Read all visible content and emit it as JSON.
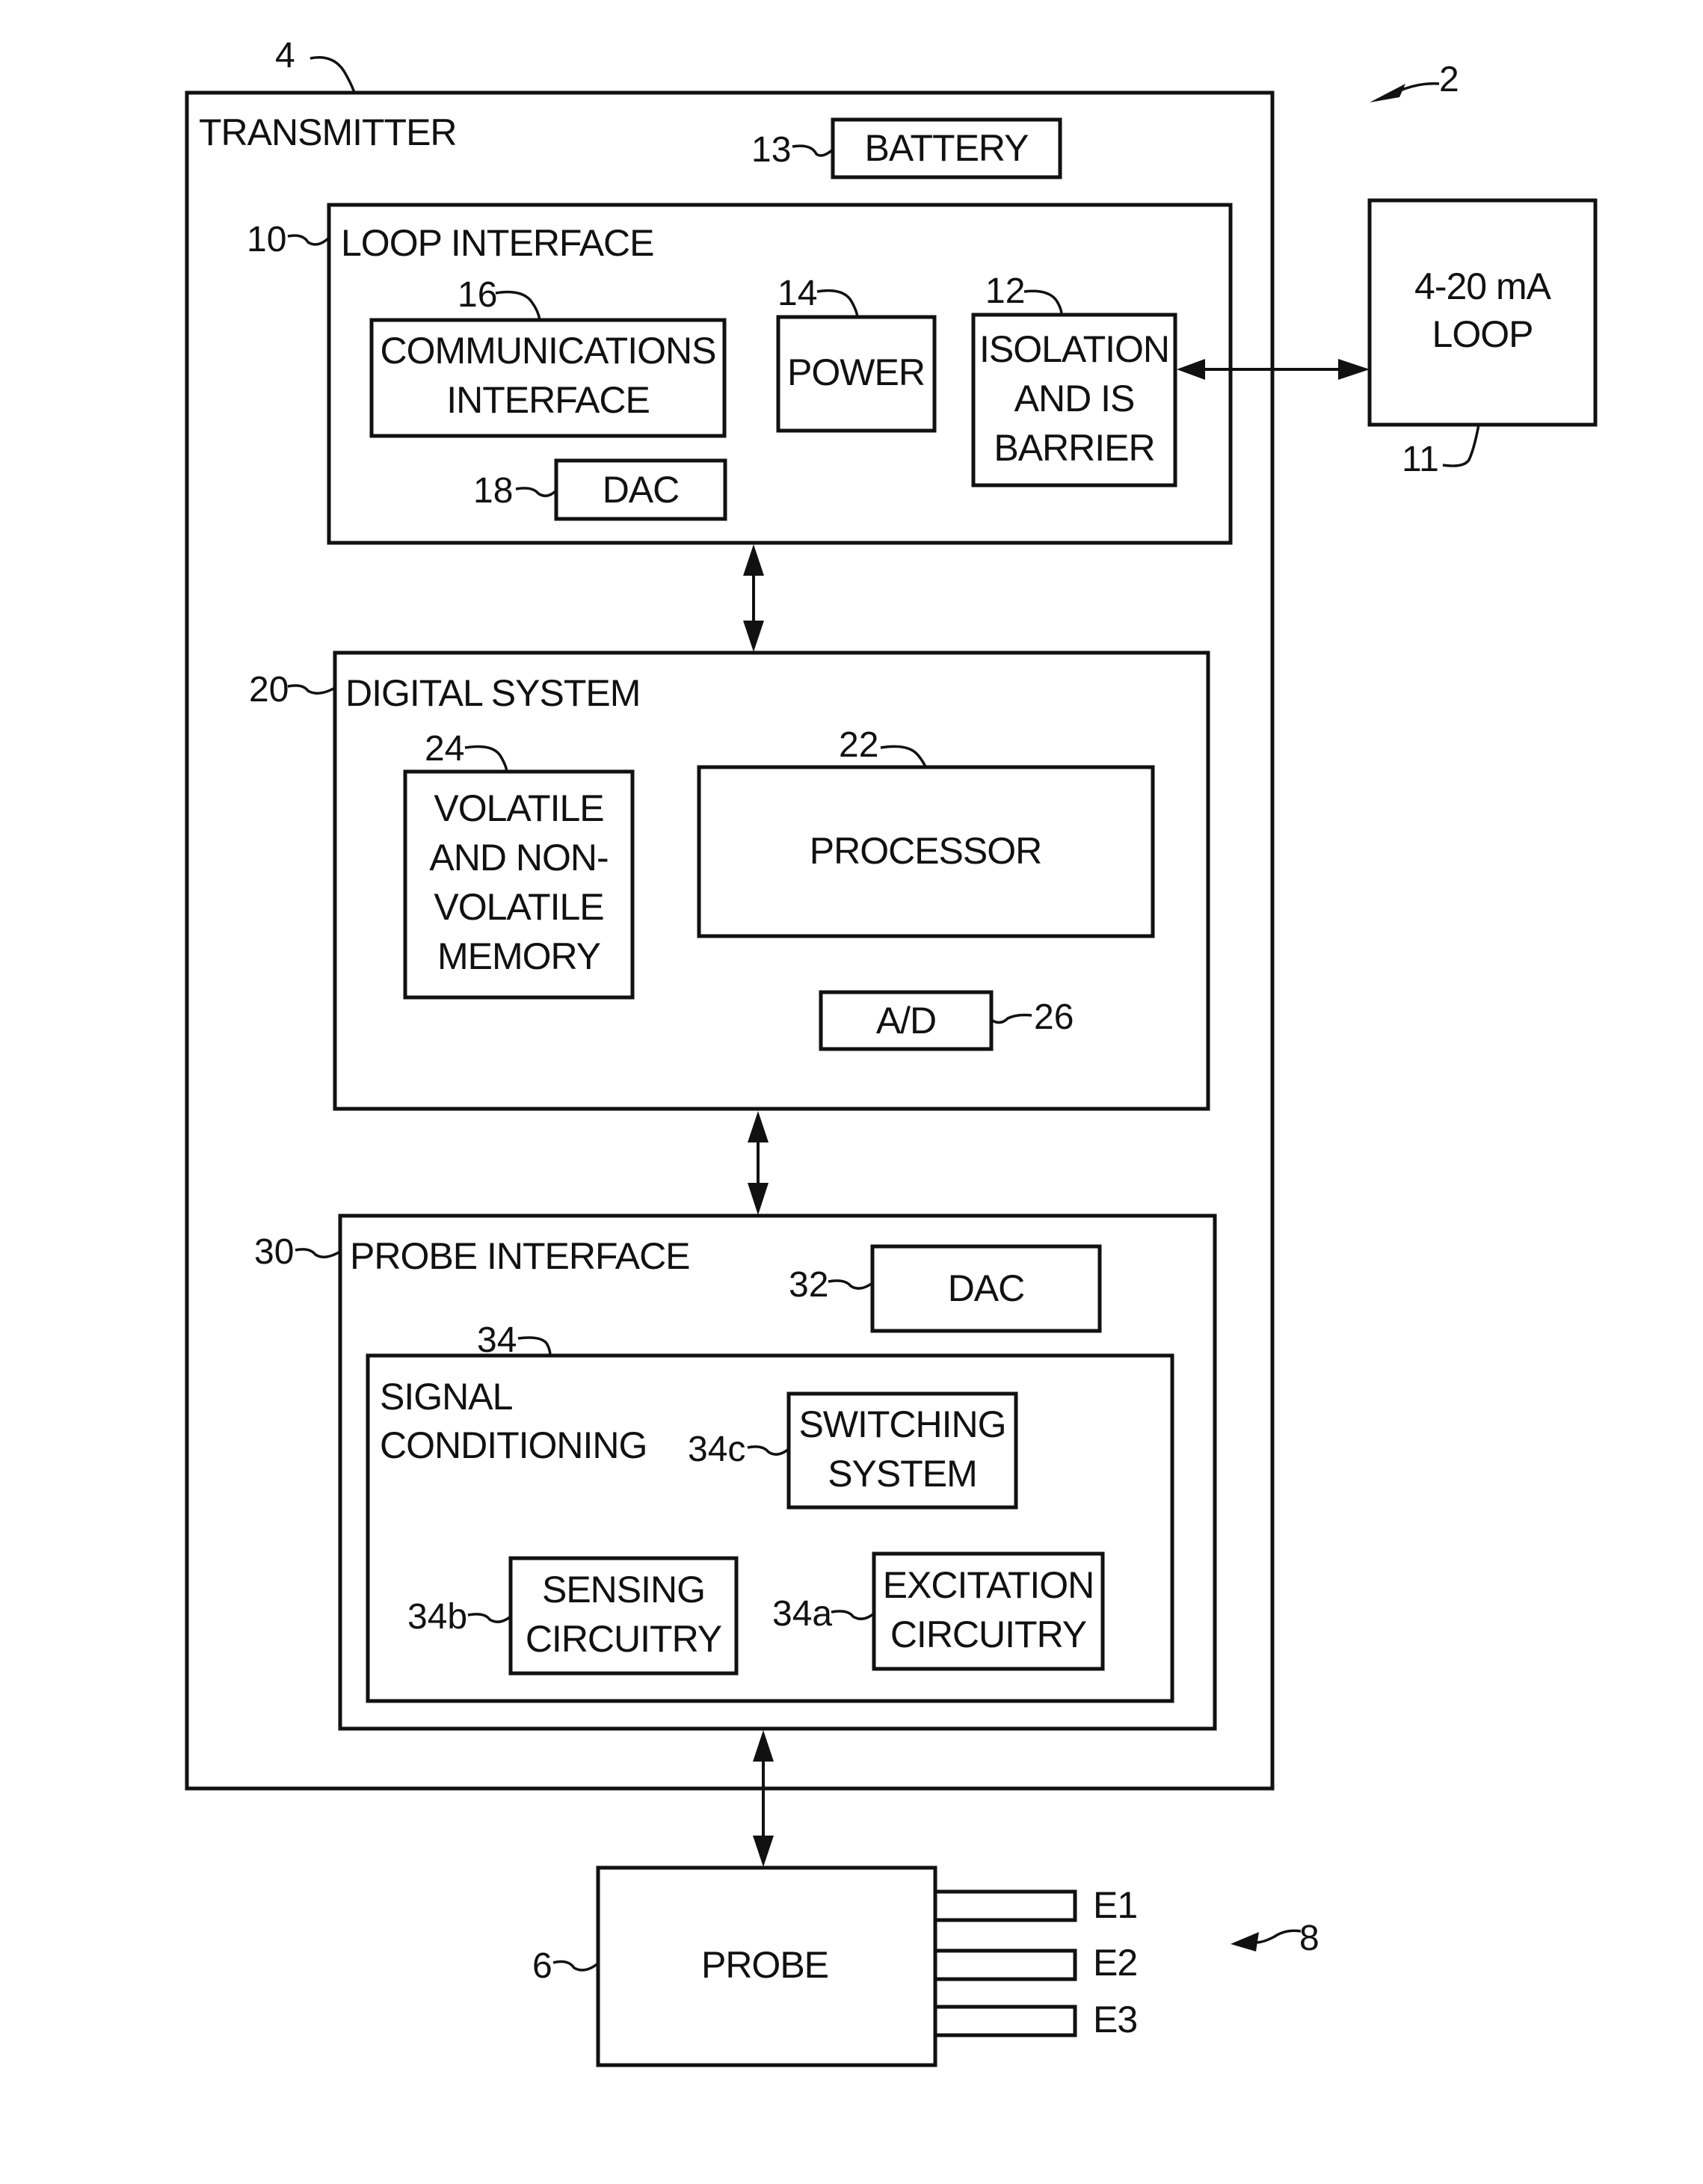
{
  "figure": {
    "ref": "2",
    "transmitter": {
      "ref": "4",
      "title": "TRANSMITTER"
    },
    "battery": {
      "ref": "13",
      "label": "BATTERY"
    },
    "loop_interface": {
      "ref": "10",
      "title": "LOOP INTERFACE",
      "communications": {
        "ref": "16",
        "lines": [
          "COMMUNICATIONS",
          "INTERFACE"
        ]
      },
      "power": {
        "ref": "14",
        "label": "POWER"
      },
      "isolation": {
        "ref": "12",
        "lines": [
          "ISOLATION",
          "AND IS",
          "BARRIER"
        ]
      },
      "dac": {
        "ref": "18",
        "label": "DAC"
      }
    },
    "loop": {
      "ref": "11",
      "lines": [
        "4-20 mA",
        "LOOP"
      ]
    },
    "digital_system": {
      "ref": "20",
      "title": "DIGITAL SYSTEM",
      "memory": {
        "ref": "24",
        "lines": [
          "VOLATILE",
          "AND NON-",
          "VOLATILE",
          "MEMORY"
        ]
      },
      "processor": {
        "ref": "22",
        "label": "PROCESSOR"
      },
      "ad": {
        "ref": "26",
        "label": "A/D"
      }
    },
    "probe_interface": {
      "ref": "30",
      "title": "PROBE INTERFACE",
      "dac": {
        "ref": "32",
        "label": "DAC"
      },
      "signal_conditioning": {
        "ref": "34",
        "lines": [
          "SIGNAL",
          "CONDITIONING"
        ],
        "switching": {
          "ref": "34c",
          "lines": [
            "SWITCHING",
            "SYSTEM"
          ]
        },
        "sensing": {
          "ref": "34b",
          "lines": [
            "SENSING",
            "CIRCUITRY"
          ]
        },
        "excitation": {
          "ref": "34a",
          "lines": [
            "EXCITATION",
            "CIRCUITRY"
          ]
        }
      }
    },
    "probe": {
      "ref": "6",
      "label": "PROBE"
    },
    "electrodes": {
      "ref": "8",
      "labels": [
        "E1",
        "E2",
        "E3"
      ]
    }
  }
}
